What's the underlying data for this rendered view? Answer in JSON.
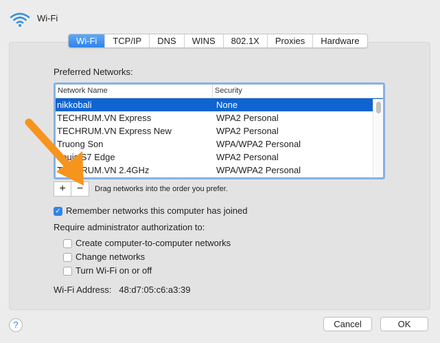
{
  "header": {
    "title": "Wi-Fi",
    "icon": "wifi-icon"
  },
  "tabs": [
    "Wi-Fi",
    "TCP/IP",
    "DNS",
    "WINS",
    "802.1X",
    "Proxies",
    "Hardware"
  ],
  "preferred_label": "Preferred Networks:",
  "columns": [
    "Network Name",
    "Security"
  ],
  "networks": [
    {
      "name": "nikkobali",
      "security": "None"
    },
    {
      "name": "TECHRUM.VN Express",
      "security": "WPA2 Personal"
    },
    {
      "name": "TECHRUM.VN Express New",
      "security": "WPA2 Personal"
    },
    {
      "name": "Truong Son",
      "security": "WPA/WPA2 Personal"
    },
    {
      "name": "Louis S7 Edge",
      "security": "WPA2 Personal"
    },
    {
      "name": "TECHRUM.VN 2.4GHz",
      "security": "WPA/WPA2 Personal"
    }
  ],
  "add_label": "+",
  "remove_label": "−",
  "drag_hint": "Drag networks into the order you prefer.",
  "remember_label": "Remember networks this computer has joined",
  "require_label": "Require administrator authorization to:",
  "options": [
    "Create computer-to-computer networks",
    "Change networks",
    "Turn Wi-Fi on or off"
  ],
  "address_label": "Wi-Fi Address:",
  "address_value": "48:d7:05:c6:a3:39",
  "help_label": "?",
  "cancel_label": "Cancel",
  "ok_label": "OK",
  "colors": {
    "accent": "#2f84ec",
    "selection": "#0f64d2",
    "arrow": "#f7941d"
  }
}
